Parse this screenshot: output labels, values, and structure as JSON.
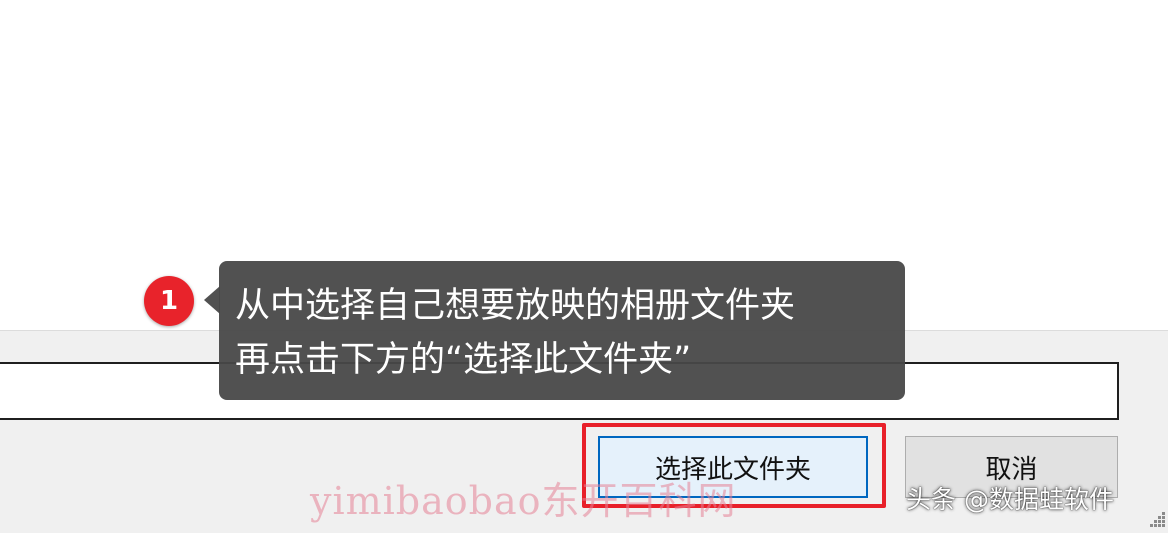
{
  "dialog": {
    "folder_input_value": "",
    "select_button_label": "选择此文件夹",
    "cancel_button_label": "取消"
  },
  "annotation": {
    "step_number": "1",
    "tooltip_line1": "从中选择自己想要放映的相册文件夹",
    "tooltip_line2": "再点击下方的“选择此文件夹”",
    "highlight_color": "#e8202a",
    "badge_color": "#e8232b"
  },
  "overlay": {
    "watermark": "yimibaobao东开百科网",
    "credit": "头条 @数据蛙软件"
  },
  "icons": {
    "resize_grip": "resize-grip-icon"
  }
}
